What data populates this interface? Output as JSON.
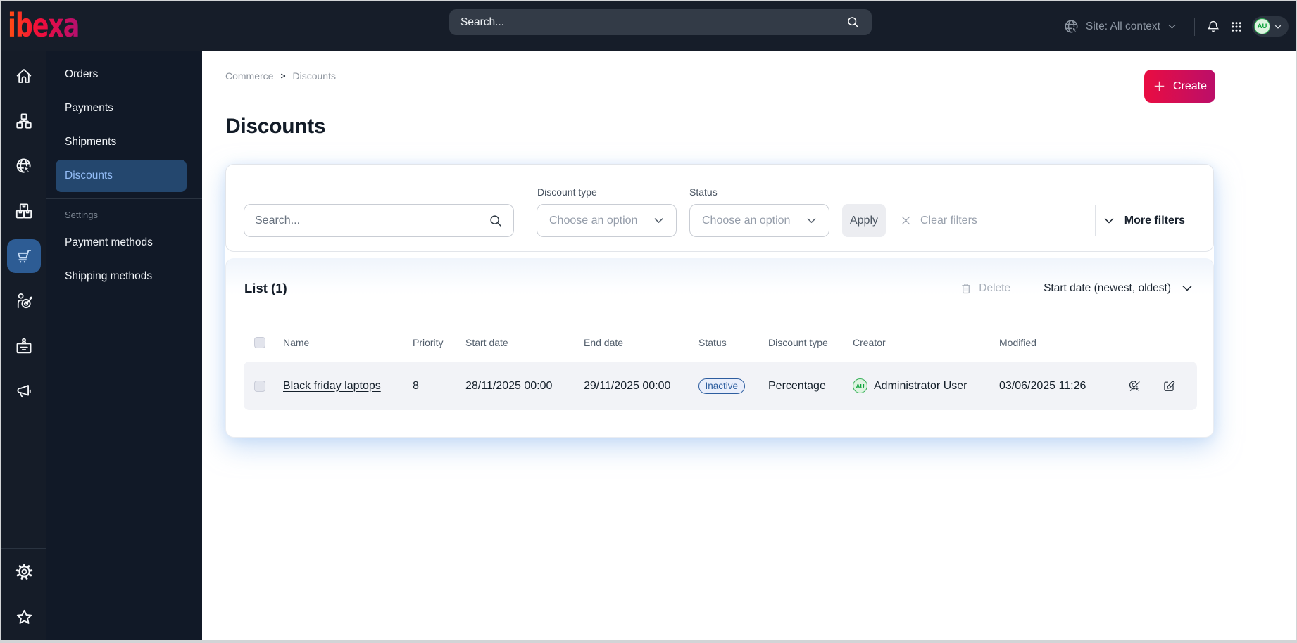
{
  "topbar": {
    "logo_text": "ibexa",
    "search_placeholder": "Search...",
    "site_context": "Site: All context",
    "avatar_initials": "AU"
  },
  "rail": {
    "items": [
      "home",
      "content-tree",
      "site",
      "products",
      "commerce",
      "personalization",
      "customer-portal",
      "marketing"
    ],
    "bottom_items": [
      "settings",
      "bookmarks"
    ],
    "active_item": "commerce"
  },
  "sidebar": {
    "items": [
      {
        "label": "Orders",
        "active": false
      },
      {
        "label": "Payments",
        "active": false
      },
      {
        "label": "Shipments",
        "active": false
      },
      {
        "label": "Discounts",
        "active": true
      }
    ],
    "section_label": "Settings",
    "settings_items": [
      {
        "label": "Payment methods"
      },
      {
        "label": "Shipping methods"
      }
    ]
  },
  "breadcrumb": {
    "items": [
      "Commerce",
      "Discounts"
    ],
    "separator": ">"
  },
  "page": {
    "title": "Discounts",
    "create_label": "Create"
  },
  "filters": {
    "search_placeholder": "Search...",
    "discount_type_label": "Discount type",
    "status_label": "Status",
    "discount_type_value": "Choose an option",
    "status_value": "Choose an option",
    "apply_label": "Apply",
    "clear_label": "Clear filters",
    "more_label": "More filters"
  },
  "list": {
    "title": "List (1)",
    "delete_label": "Delete",
    "sort_label": "Start date (newest, oldest)",
    "columns": [
      "Name",
      "Priority",
      "Start date",
      "End date",
      "Status",
      "Discount type",
      "Creator",
      "Modified"
    ],
    "rows": [
      {
        "name": "Black friday laptops",
        "priority": "8",
        "start_date": "28/11/2025 00:00",
        "end_date": "29/11/2025 00:00",
        "status": "Inactive",
        "discount_type": "Percentage",
        "creator": "Administrator User",
        "creator_initials": "AU",
        "modified": "03/06/2025 11:26"
      }
    ]
  },
  "colors": {
    "topbar_bg": "#161d29",
    "sidebar_bg": "#111927",
    "accent_gradient_start": "#e90d42",
    "accent_gradient_end": "#bb0e69",
    "active_nav_bg": "#24476e",
    "active_nav_text": "#93bcf6",
    "active_rail_bg": "#2d5c94",
    "status_badge": "#2d5d9f",
    "avatar_green": "#2fae52"
  }
}
